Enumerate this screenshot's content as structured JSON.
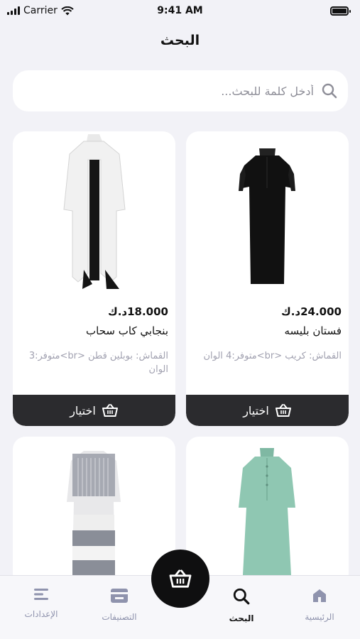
{
  "status_bar": {
    "carrier": "Carrier",
    "time": "9:41 AM"
  },
  "header": {
    "title": "البحث"
  },
  "search": {
    "placeholder": "أدخل كلمة للبحث..."
  },
  "products": [
    {
      "price": "24.000د.ك",
      "name": "فستان بليسه",
      "description": "القماش: كريب <br>متوفر:4 الوان",
      "button_label": "اختيار",
      "image": "black-dress",
      "color": "#141414"
    },
    {
      "price": "18.000د.ك",
      "name": "بنجابي كاب سحاب",
      "description": "القماش: بوبلين قطن <br>متوفر:3 الوان",
      "button_label": "اختيار",
      "image": "white-hooded-abaya",
      "color": "#f4f4f4"
    },
    {
      "image": "mint-dress",
      "color": "#8fc7b2"
    },
    {
      "image": "striped-dress",
      "color": "#8a8e98"
    }
  ],
  "bottom_nav": {
    "items": [
      {
        "label": "الرئيسية",
        "icon": "home-icon"
      },
      {
        "label": "البحث",
        "icon": "search-icon",
        "active": true
      },
      {
        "label": "التصنيفات",
        "icon": "categories-icon"
      },
      {
        "label": "الإعدادات",
        "icon": "settings-menu-icon"
      }
    ],
    "fab_icon": "basket-icon"
  }
}
